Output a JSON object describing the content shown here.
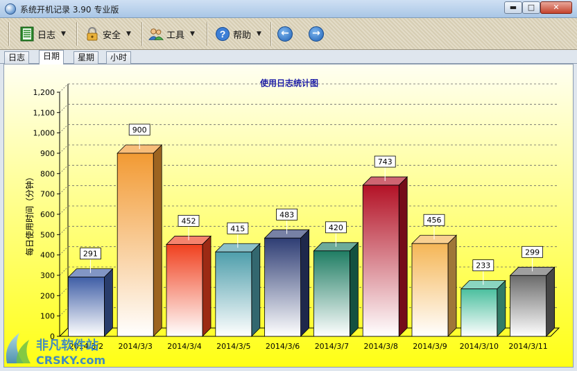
{
  "window": {
    "title": "系统开机记录 3.90 专业版",
    "min_label": "▬",
    "max_label": "□",
    "close_label": "✕"
  },
  "toolbar": {
    "items": [
      {
        "label": "日志",
        "icon": "log-book-icon"
      },
      {
        "label": "安全",
        "icon": "lock-icon"
      },
      {
        "label": "工具",
        "icon": "users-icon"
      },
      {
        "label": "帮助",
        "icon": "help-icon"
      }
    ],
    "back_icon": "arrow-left-icon",
    "forward_icon": "arrow-right-icon",
    "back_glyph": "←",
    "forward_glyph": "→",
    "caret": "▼"
  },
  "tabs": [
    {
      "label": "日志",
      "active": false
    },
    {
      "label": "日期",
      "active": true
    },
    {
      "label": "星期",
      "active": false
    },
    {
      "label": "小时",
      "active": false
    }
  ],
  "chart_data": {
    "type": "bar",
    "title": "使用日志统计图",
    "ylabel": "每日使用时间（分钟）",
    "xlabel": "",
    "categories": [
      "2014/3/2",
      "2014/3/3",
      "2014/3/4",
      "2014/3/5",
      "2014/3/6",
      "2014/3/7",
      "2014/3/8",
      "2014/3/9",
      "2014/3/10",
      "2014/3/11"
    ],
    "values": [
      291,
      900,
      452,
      415,
      483,
      420,
      743,
      456,
      233,
      299
    ],
    "ylim": [
      0,
      1200
    ],
    "yticks": [
      0,
      100,
      200,
      300,
      400,
      500,
      600,
      700,
      800,
      900,
      1000,
      1100,
      1200
    ],
    "ytick_labels": [
      "0",
      "100",
      "200",
      "300",
      "400",
      "500",
      "600",
      "700",
      "800",
      "900",
      "1,000",
      "1,100",
      "1,200"
    ],
    "grid": true,
    "bar_colors": [
      "#3f5ea6",
      "#f29a33",
      "#f0401e",
      "#4e9eab",
      "#2e3d74",
      "#1f7d63",
      "#b31226",
      "#f5b656",
      "#4bbf9e",
      "#6b6b6b"
    ],
    "title_color": "#1a1aa6",
    "background": [
      "#fffff2",
      "#ffff14"
    ]
  },
  "watermark": {
    "cn": "非凡软件站",
    "en": "CRSKY.com"
  }
}
